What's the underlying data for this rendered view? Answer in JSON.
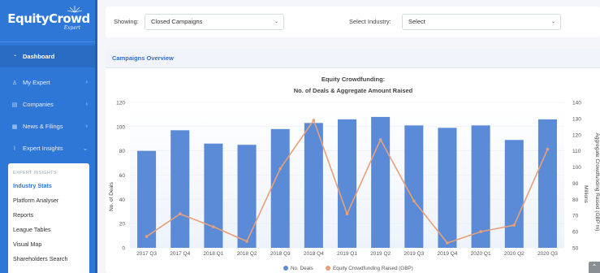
{
  "sidebar": {
    "logo": {
      "main": "EquityCrowd",
      "sub": "Expert"
    },
    "items": [
      {
        "label": "Dashboard",
        "icon": "dashboard-icon"
      },
      {
        "label": "My Expert",
        "icon": "user-icon"
      },
      {
        "label": "Companies",
        "icon": "building-icon"
      },
      {
        "label": "News & Filings",
        "icon": "newspaper-icon"
      },
      {
        "label": "Expert Insights",
        "icon": "chart-icon"
      }
    ],
    "submenu": {
      "heading": "EXPERT INSIGHTS:",
      "items": [
        "Industry Stats",
        "Platform Analyser",
        "Reports",
        "League Tables",
        "Visual Map",
        "Shareholders Search"
      ]
    }
  },
  "filters": {
    "showing_label": "Showing:",
    "showing_value": "Closed Campaigns",
    "industry_label": "Select Industry:",
    "industry_value": "Select"
  },
  "panel": {
    "title": "Campaigns Overview"
  },
  "chart_data": {
    "type": "bar",
    "title": "Equity Crowdfunding:",
    "subtitle": "No. of Deals & Aggregate Amount Raised",
    "categories": [
      "2017 Q3",
      "2017 Q4",
      "2018 Q1",
      "2018 Q2",
      "2018 Q3",
      "2018 Q4",
      "2019 Q1",
      "2019 Q2",
      "2019 Q3",
      "2019 Q4",
      "2020 Q1",
      "2020 Q2",
      "2020 Q3"
    ],
    "series": [
      {
        "name": "No. Deals",
        "type": "bar",
        "axis": "left",
        "color": "#5b8bd6",
        "values": [
          80,
          97,
          86,
          85,
          98,
          103,
          106,
          108,
          101,
          99,
          101,
          89,
          106
        ]
      },
      {
        "name": "Equity Crowdfunding Raised (GBP)",
        "type": "line",
        "axis": "right",
        "color": "#e8a07a",
        "values": [
          57,
          71,
          63,
          54,
          99,
          129,
          71,
          117,
          79,
          53,
          60,
          64,
          111
        ]
      }
    ],
    "ylabel": "No. of Deals",
    "ylabel_right": "Aggregate Crowdfunding Raised (GBP m)",
    "ylabel_right_unit": "Millions",
    "ylim": [
      0,
      120
    ],
    "yticks": [
      0,
      20,
      40,
      60,
      80,
      100,
      120
    ],
    "ylim_right": [
      50,
      140
    ],
    "yticks_right": [
      50,
      60,
      70,
      80,
      90,
      100,
      110,
      120,
      130,
      140
    ],
    "legend_position": "bottom",
    "colors": {
      "bar": "#5b8bd6",
      "line": "#e8a07a",
      "grid": "#e9edf2"
    }
  }
}
